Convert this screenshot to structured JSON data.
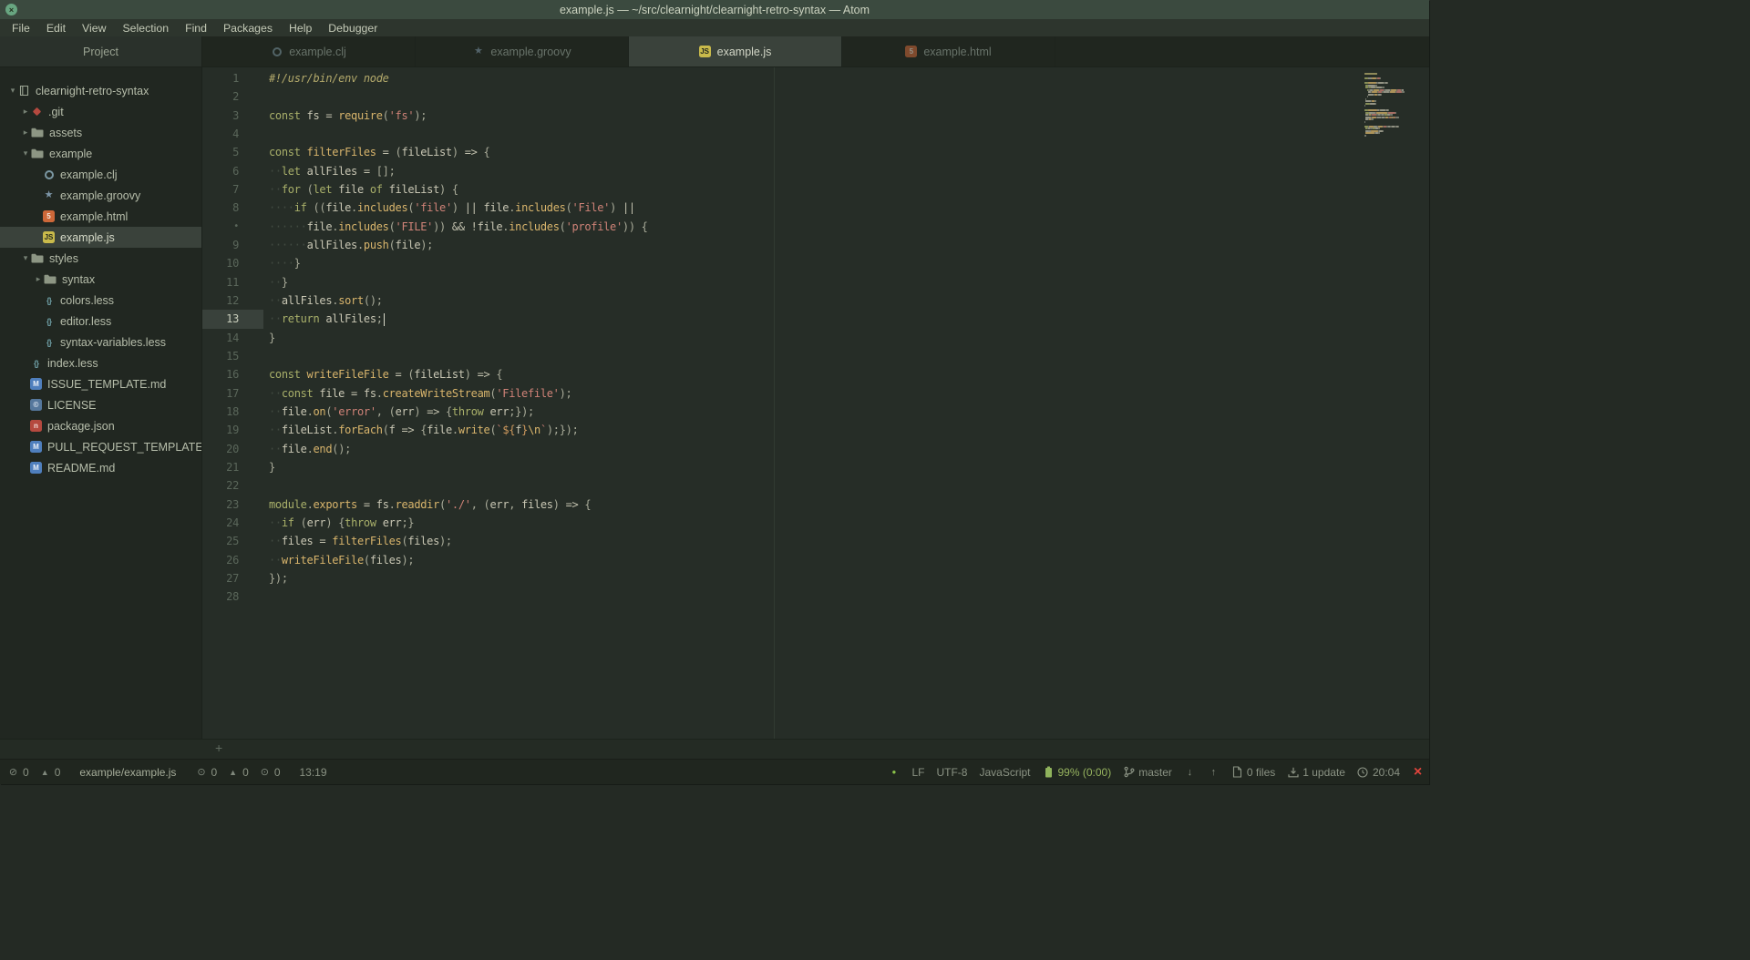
{
  "window": {
    "title": "example.js — ~/src/clearnight/clearnight-retro-syntax — Atom",
    "close_glyph": "×"
  },
  "menu": {
    "items": [
      "File",
      "Edit",
      "View",
      "Selection",
      "Find",
      "Packages",
      "Help",
      "Debugger"
    ]
  },
  "tabs": {
    "project_header": "Project",
    "items": [
      {
        "label": "example.clj",
        "icon": "clojure-icon",
        "active": false
      },
      {
        "label": "example.groovy",
        "icon": "groovy-icon",
        "active": false
      },
      {
        "label": "example.js",
        "icon": "js-icon",
        "active": true
      },
      {
        "label": "example.html",
        "icon": "html-icon",
        "active": false
      }
    ]
  },
  "tree": {
    "items": [
      {
        "label": "clearnight-retro-syntax",
        "icon": "repo-icon",
        "depth": 0,
        "chevron": "down",
        "selected": false
      },
      {
        "label": ".git",
        "icon": "git-folder-icon",
        "depth": 1,
        "chevron": "right",
        "selected": false
      },
      {
        "label": "assets",
        "icon": "folder-icon",
        "depth": 1,
        "chevron": "right",
        "selected": false
      },
      {
        "label": "example",
        "icon": "folder-icon",
        "depth": 1,
        "chevron": "down",
        "selected": false
      },
      {
        "label": "example.clj",
        "icon": "clojure-icon",
        "depth": 2,
        "chevron": "none",
        "selected": false
      },
      {
        "label": "example.groovy",
        "icon": "groovy-icon",
        "depth": 2,
        "chevron": "none",
        "selected": false
      },
      {
        "label": "example.html",
        "icon": "html-icon",
        "depth": 2,
        "chevron": "none",
        "selected": false
      },
      {
        "label": "example.js",
        "icon": "js-icon",
        "depth": 2,
        "chevron": "none",
        "selected": true
      },
      {
        "label": "styles",
        "icon": "folder-icon",
        "depth": 1,
        "chevron": "down",
        "selected": false
      },
      {
        "label": "syntax",
        "icon": "folder-icon",
        "depth": 2,
        "chevron": "right",
        "selected": false
      },
      {
        "label": "colors.less",
        "icon": "less-icon",
        "depth": 2,
        "chevron": "none",
        "selected": false
      },
      {
        "label": "editor.less",
        "icon": "less-icon",
        "depth": 2,
        "chevron": "none",
        "selected": false
      },
      {
        "label": "syntax-variables.less",
        "icon": "less-icon",
        "depth": 2,
        "chevron": "none",
        "selected": false
      },
      {
        "label": "index.less",
        "icon": "less-icon",
        "depth": 1,
        "chevron": "none",
        "selected": false
      },
      {
        "label": "ISSUE_TEMPLATE.md",
        "icon": "markdown-icon",
        "depth": 1,
        "chevron": "none",
        "selected": false
      },
      {
        "label": "LICENSE",
        "icon": "book-icon",
        "depth": 1,
        "chevron": "none",
        "selected": false
      },
      {
        "label": "package.json",
        "icon": "npm-icon",
        "depth": 1,
        "chevron": "none",
        "selected": false
      },
      {
        "label": "PULL_REQUEST_TEMPLATE.md",
        "icon": "markdown-icon",
        "depth": 1,
        "chevron": "none",
        "selected": false
      },
      {
        "label": "README.md",
        "icon": "markdown-icon",
        "depth": 1,
        "chevron": "none",
        "selected": false
      }
    ]
  },
  "editor": {
    "cursor_line": "13",
    "bottom_dock_plus": "+",
    "lines": [
      {
        "num": "1",
        "tokens": [
          [
            "sheb",
            "#!/usr/bin/env node"
          ]
        ]
      },
      {
        "num": "2",
        "tokens": []
      },
      {
        "num": "3",
        "tokens": [
          [
            "k",
            "const"
          ],
          [
            "v",
            " fs "
          ],
          [
            "o",
            "= "
          ],
          [
            "fn",
            "require"
          ],
          [
            "p",
            "("
          ],
          [
            "s",
            "'fs'"
          ],
          [
            "p",
            ");"
          ]
        ]
      },
      {
        "num": "4",
        "tokens": []
      },
      {
        "num": "5",
        "tokens": [
          [
            "k",
            "const"
          ],
          [
            "fn",
            " filterFiles "
          ],
          [
            "o",
            "= "
          ],
          [
            "p",
            "("
          ],
          [
            "v",
            "fileList"
          ],
          [
            "p",
            ") "
          ],
          [
            "o",
            "=> "
          ],
          [
            "p",
            "{"
          ]
        ]
      },
      {
        "num": "6",
        "tokens": [
          [
            "d",
            "··"
          ],
          [
            "k",
            "let"
          ],
          [
            "v",
            " allFiles "
          ],
          [
            "o",
            "= "
          ],
          [
            "p",
            "[];"
          ]
        ]
      },
      {
        "num": "7",
        "tokens": [
          [
            "d",
            "··"
          ],
          [
            "k",
            "for"
          ],
          [
            "p",
            " ("
          ],
          [
            "k",
            "let"
          ],
          [
            "v",
            " file "
          ],
          [
            "k",
            "of"
          ],
          [
            "v",
            " fileList"
          ],
          [
            "p",
            ") {"
          ]
        ]
      },
      {
        "num": "8",
        "tokens": [
          [
            "d",
            "····"
          ],
          [
            "k",
            "if"
          ],
          [
            "p",
            " (("
          ],
          [
            "v",
            "file"
          ],
          [
            "p",
            "."
          ],
          [
            "fn",
            "includes"
          ],
          [
            "p",
            "("
          ],
          [
            "s",
            "'file'"
          ],
          [
            "p",
            ") "
          ],
          [
            "o",
            "|| "
          ],
          [
            "v",
            "file"
          ],
          [
            "p",
            "."
          ],
          [
            "fn",
            "includes"
          ],
          [
            "p",
            "("
          ],
          [
            "s",
            "'File'"
          ],
          [
            "p",
            ") "
          ],
          [
            "o",
            "||"
          ]
        ]
      },
      {
        "num": "•",
        "wrap": true,
        "tokens": [
          [
            "d",
            "······"
          ],
          [
            "v",
            "file"
          ],
          [
            "p",
            "."
          ],
          [
            "fn",
            "includes"
          ],
          [
            "p",
            "("
          ],
          [
            "s",
            "'FILE'"
          ],
          [
            "p",
            ")) "
          ],
          [
            "o",
            "&& !"
          ],
          [
            "v",
            "file"
          ],
          [
            "p",
            "."
          ],
          [
            "fn",
            "includes"
          ],
          [
            "p",
            "("
          ],
          [
            "s",
            "'profile'"
          ],
          [
            "p",
            ")) {"
          ]
        ]
      },
      {
        "num": "9",
        "tokens": [
          [
            "d",
            "······"
          ],
          [
            "v",
            "allFiles"
          ],
          [
            "p",
            "."
          ],
          [
            "fn",
            "push"
          ],
          [
            "p",
            "("
          ],
          [
            "v",
            "file"
          ],
          [
            "p",
            ");"
          ]
        ]
      },
      {
        "num": "10",
        "tokens": [
          [
            "d",
            "····"
          ],
          [
            "p",
            "}"
          ]
        ]
      },
      {
        "num": "11",
        "tokens": [
          [
            "d",
            "··"
          ],
          [
            "p",
            "}"
          ]
        ]
      },
      {
        "num": "12",
        "tokens": [
          [
            "d",
            "··"
          ],
          [
            "v",
            "allFiles"
          ],
          [
            "p",
            "."
          ],
          [
            "fn",
            "sort"
          ],
          [
            "p",
            "();"
          ]
        ]
      },
      {
        "num": "13",
        "cursor": true,
        "tokens": [
          [
            "d",
            "··"
          ],
          [
            "k",
            "return"
          ],
          [
            "v",
            " allFiles"
          ],
          [
            "p",
            ";"
          ]
        ]
      },
      {
        "num": "14",
        "tokens": [
          [
            "p",
            "}"
          ]
        ]
      },
      {
        "num": "15",
        "tokens": []
      },
      {
        "num": "16",
        "tokens": [
          [
            "k",
            "const"
          ],
          [
            "fn",
            " writeFileFile "
          ],
          [
            "o",
            "= "
          ],
          [
            "p",
            "("
          ],
          [
            "v",
            "fileList"
          ],
          [
            "p",
            ") "
          ],
          [
            "o",
            "=> "
          ],
          [
            "p",
            "{"
          ]
        ]
      },
      {
        "num": "17",
        "tokens": [
          [
            "d",
            "··"
          ],
          [
            "k",
            "const"
          ],
          [
            "v",
            " file "
          ],
          [
            "o",
            "= "
          ],
          [
            "v",
            "fs"
          ],
          [
            "p",
            "."
          ],
          [
            "fn",
            "createWriteStream"
          ],
          [
            "p",
            "("
          ],
          [
            "s",
            "'Filefile'"
          ],
          [
            "p",
            ");"
          ]
        ]
      },
      {
        "num": "18",
        "tokens": [
          [
            "d",
            "··"
          ],
          [
            "v",
            "file"
          ],
          [
            "p",
            "."
          ],
          [
            "fn",
            "on"
          ],
          [
            "p",
            "("
          ],
          [
            "s",
            "'error'"
          ],
          [
            "p",
            ", ("
          ],
          [
            "v",
            "err"
          ],
          [
            "p",
            ") "
          ],
          [
            "o",
            "=> "
          ],
          [
            "p",
            "{"
          ],
          [
            "k",
            "throw"
          ],
          [
            "v",
            " err"
          ],
          [
            "p",
            ";});"
          ]
        ]
      },
      {
        "num": "19",
        "tokens": [
          [
            "d",
            "··"
          ],
          [
            "v",
            "fileList"
          ],
          [
            "p",
            "."
          ],
          [
            "fn",
            "forEach"
          ],
          [
            "p",
            "("
          ],
          [
            "v",
            "f "
          ],
          [
            "o",
            "=> "
          ],
          [
            "p",
            "{"
          ],
          [
            "v",
            "file"
          ],
          [
            "p",
            "."
          ],
          [
            "fn",
            "write"
          ],
          [
            "p",
            "("
          ],
          [
            "s",
            "`"
          ],
          [
            "i",
            "${"
          ],
          [
            "v",
            "f"
          ],
          [
            "i",
            "}"
          ],
          [
            "e",
            "\\n"
          ],
          [
            "s",
            "`"
          ],
          [
            "p",
            ");});"
          ]
        ]
      },
      {
        "num": "20",
        "tokens": [
          [
            "d",
            "··"
          ],
          [
            "v",
            "file"
          ],
          [
            "p",
            "."
          ],
          [
            "fn",
            "end"
          ],
          [
            "p",
            "();"
          ]
        ]
      },
      {
        "num": "21",
        "tokens": [
          [
            "p",
            "}"
          ]
        ]
      },
      {
        "num": "22",
        "tokens": []
      },
      {
        "num": "23",
        "tokens": [
          [
            "k",
            "module"
          ],
          [
            "p",
            "."
          ],
          [
            "fn",
            "exports"
          ],
          [
            "o",
            " = "
          ],
          [
            "v",
            "fs"
          ],
          [
            "p",
            "."
          ],
          [
            "fn",
            "readdir"
          ],
          [
            "p",
            "("
          ],
          [
            "s",
            "'./'"
          ],
          [
            "p",
            ", ("
          ],
          [
            "v",
            "err"
          ],
          [
            "p",
            ", "
          ],
          [
            "v",
            "files"
          ],
          [
            "p",
            ") "
          ],
          [
            "o",
            "=> "
          ],
          [
            "p",
            "{"
          ]
        ]
      },
      {
        "num": "24",
        "tokens": [
          [
            "d",
            "··"
          ],
          [
            "k",
            "if"
          ],
          [
            "p",
            " ("
          ],
          [
            "v",
            "err"
          ],
          [
            "p",
            ") {"
          ],
          [
            "k",
            "throw"
          ],
          [
            "v",
            " err"
          ],
          [
            "p",
            ";}"
          ]
        ]
      },
      {
        "num": "25",
        "tokens": [
          [
            "d",
            "··"
          ],
          [
            "v",
            "files"
          ],
          [
            "o",
            " = "
          ],
          [
            "fn",
            "filterFiles"
          ],
          [
            "p",
            "("
          ],
          [
            "v",
            "files"
          ],
          [
            "p",
            ");"
          ]
        ]
      },
      {
        "num": "26",
        "tokens": [
          [
            "d",
            "··"
          ],
          [
            "fn",
            "writeFileFile"
          ],
          [
            "p",
            "("
          ],
          [
            "v",
            "files"
          ],
          [
            "p",
            ");"
          ]
        ]
      },
      {
        "num": "27",
        "tokens": [
          [
            "p",
            "});"
          ]
        ]
      },
      {
        "num": "28",
        "tokens": []
      }
    ]
  },
  "statusbar": {
    "left": [
      {
        "name": "project-errors",
        "icon": "circle-slash-icon",
        "count": "0"
      },
      {
        "name": "project-warnings",
        "icon": "warning-triangle-icon",
        "count": "0"
      },
      {
        "name": "file-path",
        "label": "example/example.js"
      },
      {
        "name": "file-errors",
        "icon": "circle-dot-icon",
        "count": "0"
      },
      {
        "name": "file-warnings",
        "icon": "warning-triangle-icon",
        "count": "0"
      },
      {
        "name": "file-infos",
        "icon": "circle-dot-icon",
        "count": "0"
      },
      {
        "name": "cursor-position",
        "label": "13:19"
      }
    ],
    "right": [
      {
        "name": "linter-status-dot",
        "icon": "green-dot-icon"
      },
      {
        "name": "line-ending",
        "label": "LF"
      },
      {
        "name": "encoding",
        "label": "UTF-8"
      },
      {
        "name": "grammar",
        "label": "JavaScript"
      },
      {
        "name": "battery",
        "icon": "battery-icon",
        "label": "99% (0:00)"
      },
      {
        "name": "git-branch",
        "icon": "git-branch-icon",
        "label": "master"
      },
      {
        "name": "git-pull",
        "icon": "arrow-down-icon"
      },
      {
        "name": "git-push",
        "icon": "arrow-up-icon"
      },
      {
        "name": "changed-files",
        "icon": "file-icon",
        "label": "0 files"
      },
      {
        "name": "updates",
        "icon": "update-icon",
        "label": "1 update"
      },
      {
        "name": "clock",
        "icon": "clock-icon",
        "label": "20:04"
      },
      {
        "name": "notification-close",
        "icon": "close-x-icon"
      }
    ]
  },
  "colors": {
    "titlebar_bg": "#3b4a3f",
    "editor_bg": "#262d27",
    "active_tab_bg": "#3a423b",
    "selected_row_bg": "#3a423b",
    "keyword": "#a9b06a",
    "function": "#d9b56c",
    "string": "#d08378",
    "text": "#c9c7b4",
    "line_number": "#5a665a",
    "battery_green": "#8fb35c",
    "status_green_dot": "#8bc34a",
    "error_red": "#e0443c",
    "js_icon_yellow": "#c9ba4b",
    "html_icon_orange": "#cd6839"
  }
}
